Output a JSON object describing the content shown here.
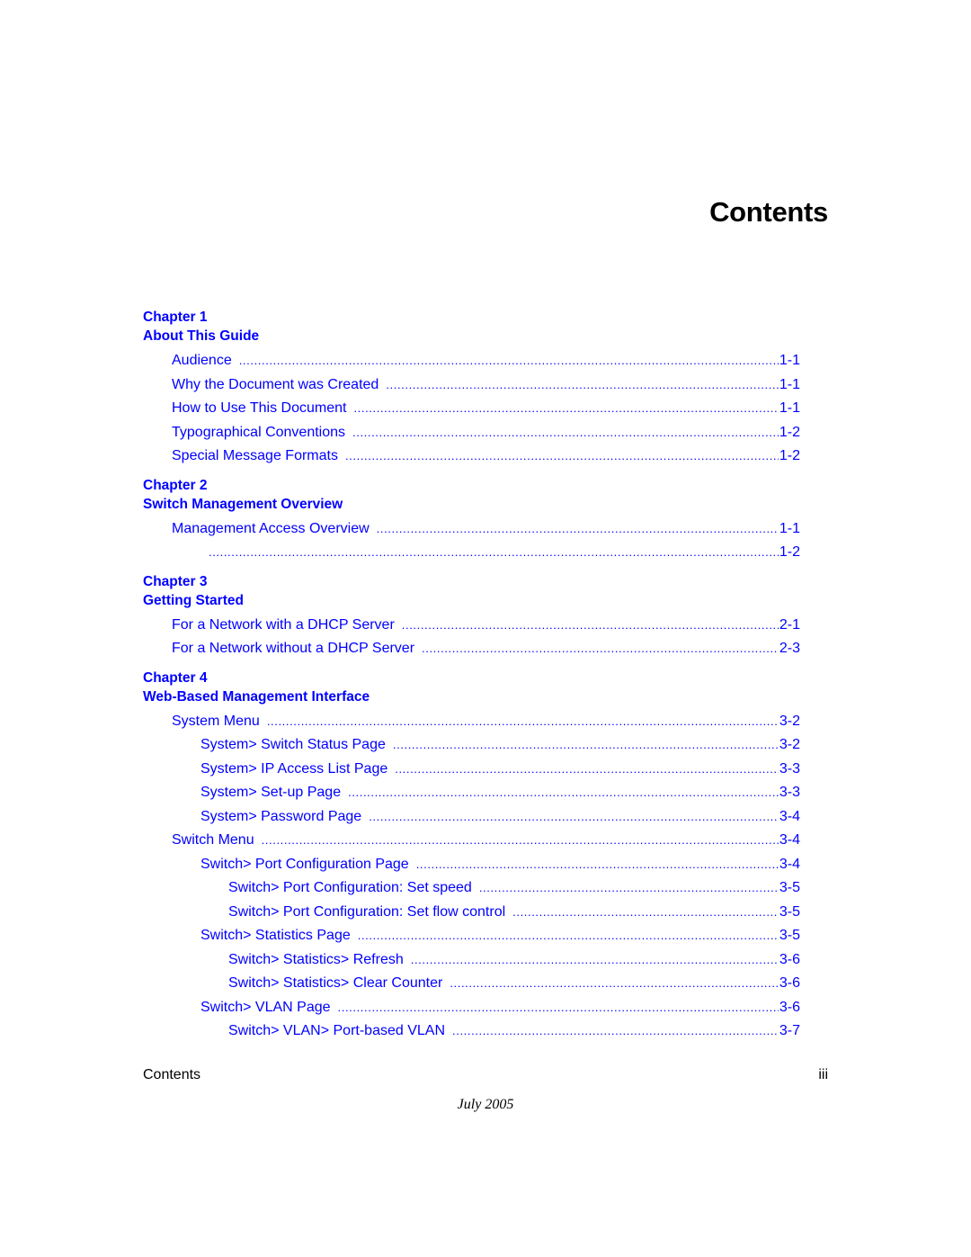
{
  "page": {
    "title": "Contents",
    "footer_left": "Contents",
    "footer_right": "iii",
    "footer_date": "July 2005"
  },
  "colors": {
    "link": "#0000ff",
    "text": "#000000"
  },
  "chapters": [
    {
      "number": "Chapter 1",
      "title": "About This Guide",
      "entries": [
        {
          "label": "Audience",
          "page": "1-1",
          "level": 1
        },
        {
          "label": "Why the Document was Created",
          "page": "1-1",
          "level": 1
        },
        {
          "label": "How to Use This Document",
          "page": "1-1",
          "level": 1
        },
        {
          "label": "Typographical Conventions",
          "page": "1-2",
          "level": 1
        },
        {
          "label": "Special Message Formats",
          "page": "1-2",
          "level": 1
        }
      ]
    },
    {
      "number": "Chapter 2",
      "title": "Switch Management Overview",
      "entries": [
        {
          "label": "Management Access Overview",
          "page": "1-1",
          "level": 1
        },
        {
          "label": "",
          "page": "1-2",
          "level": 2
        }
      ]
    },
    {
      "number": "Chapter 3",
      "title": "Getting Started",
      "entries": [
        {
          "label": "For a Network with a DHCP Server",
          "page": "2-1",
          "level": 1
        },
        {
          "label": "For a Network without a DHCP Server",
          "page": "2-3",
          "level": 1
        }
      ]
    },
    {
      "number": "Chapter 4",
      "title": "Web-Based Management Interface",
      "entries": [
        {
          "label": "System Menu",
          "page": "3-2",
          "level": 1
        },
        {
          "label": "System> Switch Status Page",
          "page": "3-2",
          "level": 2
        },
        {
          "label": "System> IP Access List Page",
          "page": "3-3",
          "level": 2
        },
        {
          "label": "System> Set-up Page",
          "page": "3-3",
          "level": 2
        },
        {
          "label": "System> Password Page",
          "page": "3-4",
          "level": 2
        },
        {
          "label": "Switch Menu",
          "page": "3-4",
          "level": 1
        },
        {
          "label": "Switch> Port Configuration Page",
          "page": "3-4",
          "level": 2
        },
        {
          "label": "Switch> Port Configuration: Set speed",
          "page": "3-5",
          "level": 3
        },
        {
          "label": "Switch> Port Configuration: Set flow control",
          "page": "3-5",
          "level": 3
        },
        {
          "label": "Switch> Statistics Page",
          "page": "3-5",
          "level": 2
        },
        {
          "label": "Switch> Statistics> Refresh",
          "page": "3-6",
          "level": 3
        },
        {
          "label": "Switch> Statistics> Clear Counter",
          "page": "3-6",
          "level": 3
        },
        {
          "label": "Switch> VLAN Page",
          "page": "3-6",
          "level": 2
        },
        {
          "label": "Switch> VLAN> Port-based VLAN",
          "page": "3-7",
          "level": 3
        }
      ]
    }
  ]
}
